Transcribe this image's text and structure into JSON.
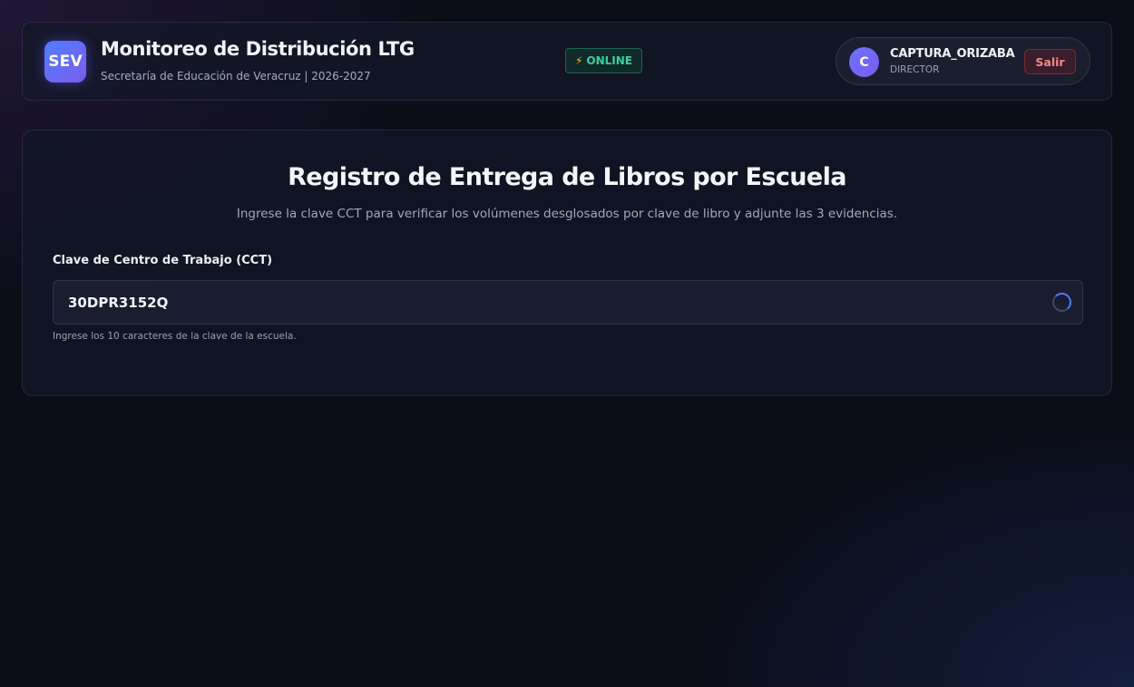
{
  "header": {
    "logo_text": "SEV",
    "title": "Monitoreo de Distribución LTG",
    "subtitle": "Secretaría de Educación de Veracruz | 2026-2027",
    "status": {
      "icon": "⚡",
      "label": "ONLINE",
      "color": "#34d399"
    },
    "user": {
      "avatar_initial": "C",
      "name": "CAPTURA_ORIZABA",
      "role": "DIRECTOR",
      "logout_label": "Salir"
    }
  },
  "main": {
    "title": "Registro de Entrega de Libros por Escuela",
    "subtitle": "Ingrese la clave CCT para verificar los volúmenes desglosados por clave de libro y adjunte las 3 evidencias.",
    "cct_field": {
      "label": "Clave de Centro de Trabajo (CCT)",
      "value": "30DPR3152Q",
      "hint": "Ingrese los 10 caracteres de la clave de la escuela.",
      "status_icon": "spinner-icon"
    }
  },
  "colors": {
    "accent": "#4f7dff",
    "online": "#34d399",
    "danger": "#f58a8a",
    "background": "#0b0d18"
  }
}
